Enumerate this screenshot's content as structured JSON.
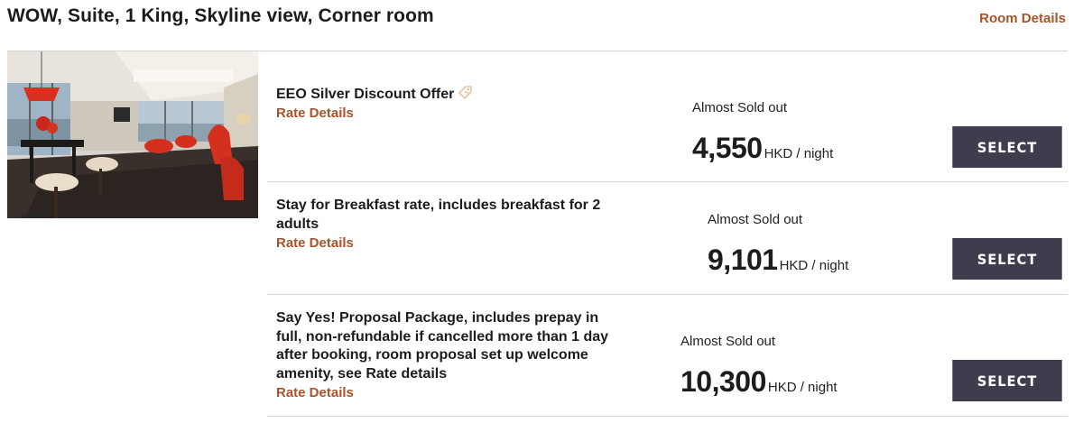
{
  "room": {
    "title": "WOW, Suite, 1 King, Skyline view, Corner room",
    "details_link": "Room Details",
    "photo_icon": "gallery-icon"
  },
  "colors": {
    "accent": "#a8542a",
    "button_bg": "#3f3d4d",
    "divider": "#d6d6d6"
  },
  "rates": [
    {
      "name": "EEO Silver Discount Offer",
      "name_icon": "tag-icon",
      "details_label": "Rate Details",
      "availability": "Almost Sold out",
      "price": "4,550",
      "unit": "HKD / night",
      "button_label": "SELECT"
    },
    {
      "name": "Stay for Breakfast rate, includes breakfast for 2 adults",
      "details_label": "Rate Details",
      "availability": "Almost Sold out",
      "price": "9,101",
      "unit": "HKD / night",
      "button_label": "SELECT"
    },
    {
      "name": "Say Yes! Proposal Package, includes prepay in full, non-refundable if cancelled more than 1 day after booking, room proposal set up welcome amenity, see Rate details",
      "details_label": "Rate Details",
      "availability": "Almost Sold out",
      "price": "10,300",
      "unit": "HKD / night",
      "button_label": "SELECT"
    }
  ]
}
